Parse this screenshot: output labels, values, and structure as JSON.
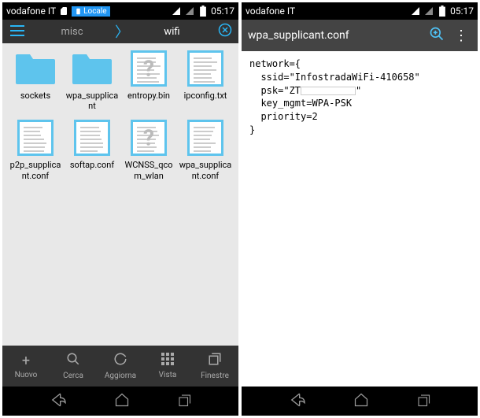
{
  "status": {
    "carrier": "vodafone IT",
    "time": "05:17",
    "locale_label": "Locale"
  },
  "breadcrumb": {
    "items": [
      "misc",
      "wifi"
    ]
  },
  "files": [
    {
      "name": "sockets",
      "type": "folder"
    },
    {
      "name": "wpa_supplicant",
      "type": "folder"
    },
    {
      "name": "entropy.bin",
      "type": "unknown"
    },
    {
      "name": "ipconfig.txt",
      "type": "doc"
    },
    {
      "name": "p2p_supplicant.conf",
      "type": "doc"
    },
    {
      "name": "softap.conf",
      "type": "doc"
    },
    {
      "name": "WCNSS_qcom_wlan",
      "type": "unknown"
    },
    {
      "name": "wpa_supplicant.conf",
      "type": "doc"
    }
  ],
  "toolbar": {
    "nuovo": "Nuovo",
    "cerca": "Cerca",
    "aggiorna": "Aggiorna",
    "vista": "Vista",
    "finestre": "Finestre"
  },
  "editor": {
    "filename": "wpa_supplicant.conf",
    "lines": [
      "network={",
      "  ssid=\"InfostradaWiFi-410658\"",
      "  psk=\"ZT",
      "  key_mgmt=WPA-PSK",
      "  priority=2",
      "}"
    ],
    "psk_suffix": "\""
  }
}
